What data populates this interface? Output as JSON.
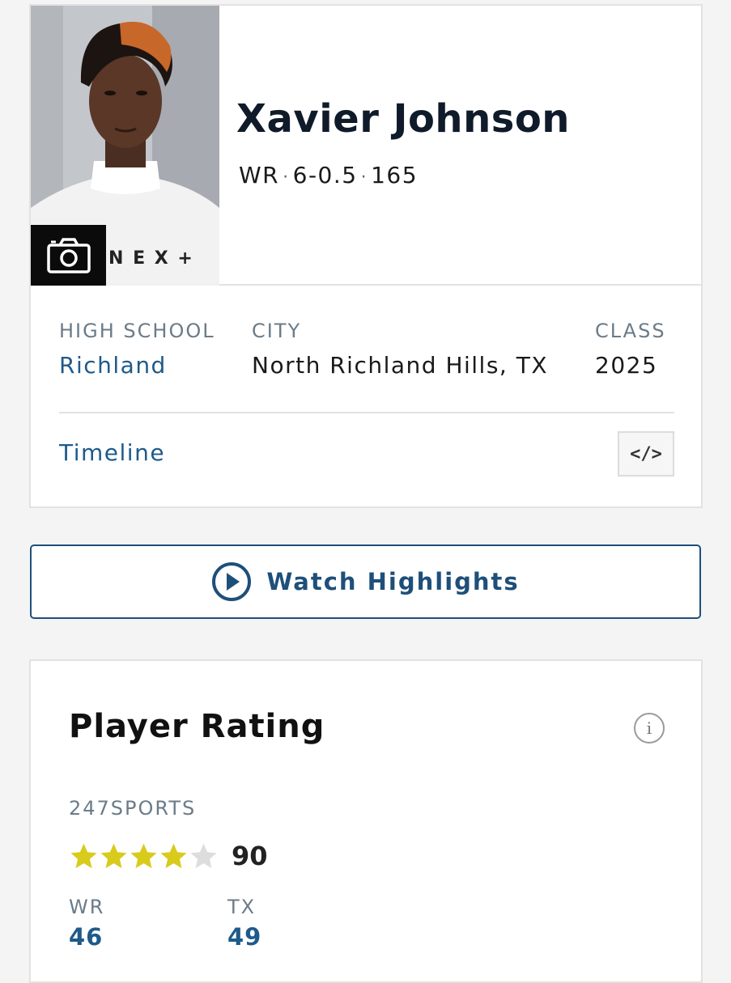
{
  "player": {
    "name": "Xavier Johnson",
    "position": "WR",
    "height": "6-0.5",
    "weight": "165",
    "photo_logo_text": "N E X +"
  },
  "details": {
    "high_school_label": "HIGH SCHOOL",
    "high_school": "Richland",
    "city_label": "CITY",
    "city": "North Richland Hills, TX",
    "class_label": "CLASS",
    "class_year": "2025"
  },
  "timeline_label": "Timeline",
  "embed_icon": "code-embed-icon",
  "highlights": {
    "label": "Watch Highlights",
    "icon": "play-circle-icon"
  },
  "rating": {
    "title": "Player Rating",
    "source": "247SPORTS",
    "stars_filled": 4,
    "stars_total": 5,
    "score": "90",
    "ranks": [
      {
        "label": "WR",
        "value": "46"
      },
      {
        "label": "TX",
        "value": "49"
      }
    ]
  },
  "colors": {
    "link_blue": "#1e5a8a",
    "star_gold": "#d8cb1c",
    "star_empty": "#dddddd",
    "label_gray": "#6b7b88"
  }
}
